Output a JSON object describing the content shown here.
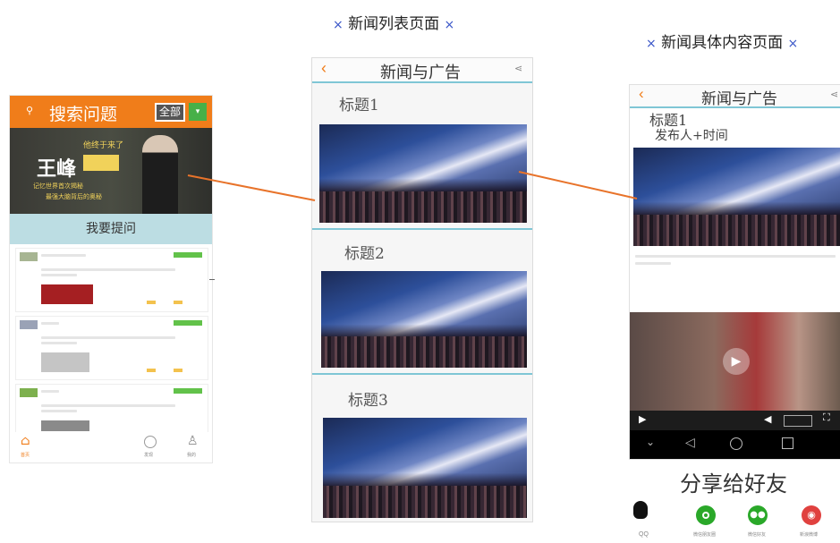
{
  "captions": {
    "list_page": "新闻列表页面",
    "detail_page": "新闻具体内容页面",
    "close_mark": "×"
  },
  "left_phone": {
    "search_title": "搜索问题",
    "filter_label": "全部",
    "banner": {
      "name": "王峰",
      "tagline": "他终于来了",
      "line1": "记忆世界首次揭秘",
      "line2": "最强大脑背后的奥秘"
    },
    "ask_button": "我要提问",
    "nav": [
      "首页",
      "发现",
      "我的"
    ]
  },
  "middle_phone": {
    "header_title": "新闻与广告",
    "back_icon": "‹",
    "items": [
      {
        "title": "标题1"
      },
      {
        "title": "标题2"
      },
      {
        "title": "标题3"
      }
    ]
  },
  "right_phone": {
    "header_title": "新闻与广告",
    "back_icon": "‹",
    "article_title": "标题1",
    "article_meta": "发布人+时间",
    "share_label": "分享给好友",
    "share_targets": [
      {
        "label": "QQ",
        "color": "#111111",
        "icon": "qq-icon"
      },
      {
        "label": "微信朋友圈",
        "color": "#2aa829",
        "icon": "moments-icon"
      },
      {
        "label": "微信好友",
        "color": "#2aa829",
        "icon": "wechat-icon"
      },
      {
        "label": "新浪微博",
        "color": "#e0413f",
        "icon": "weibo-icon"
      }
    ]
  },
  "colors": {
    "accent_orange": "#f07d1a",
    "connector": "#e8732a",
    "tag_green": "#62c24a"
  }
}
